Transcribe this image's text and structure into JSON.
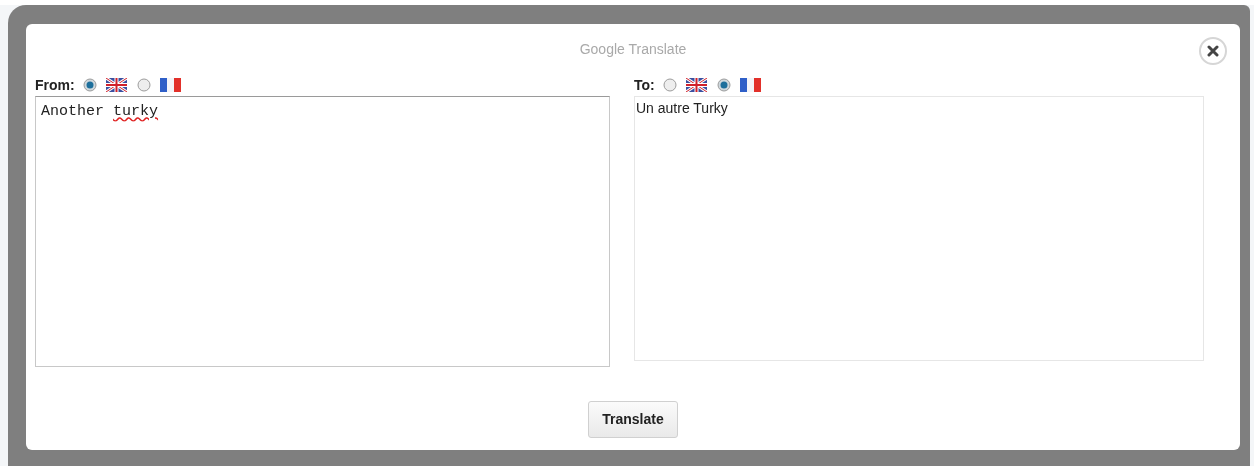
{
  "dialog": {
    "title": "Google Translate"
  },
  "from": {
    "label": "From:",
    "options": [
      {
        "kind": "uk",
        "selected": true
      },
      {
        "kind": "fr",
        "selected": false
      }
    ],
    "words": [
      {
        "text": "Another",
        "misspelled": false
      },
      {
        "text": "turky",
        "misspelled": true
      }
    ]
  },
  "to": {
    "label": "To:",
    "options": [
      {
        "kind": "uk",
        "selected": false
      },
      {
        "kind": "fr",
        "selected": true
      }
    ],
    "text": "Un autre Turky"
  },
  "button": "Translate"
}
